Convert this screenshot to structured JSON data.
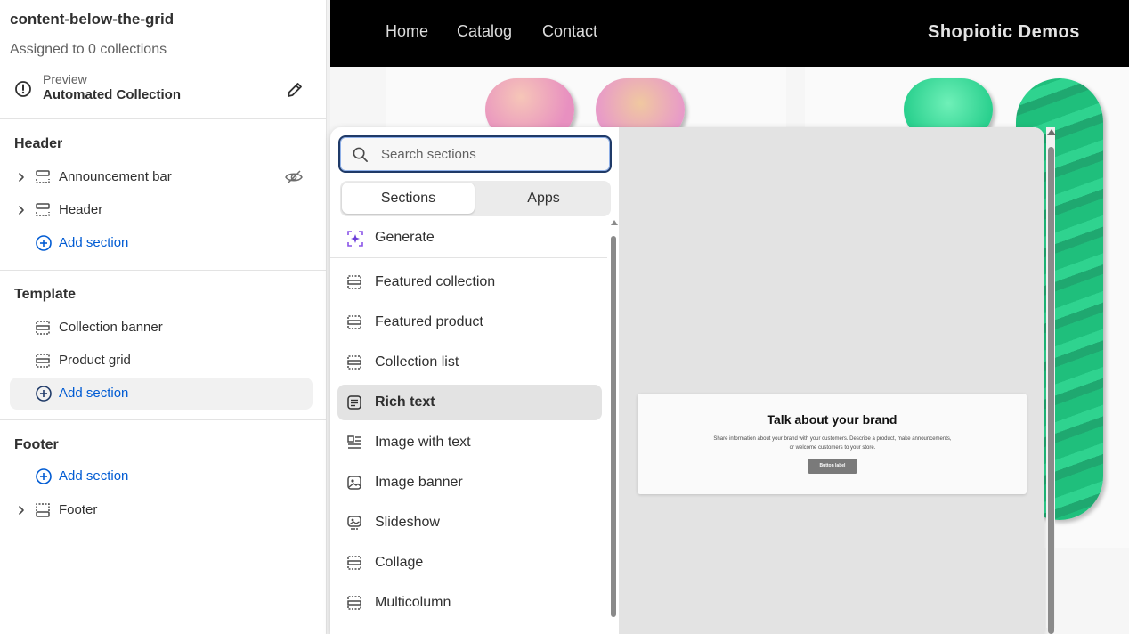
{
  "sidebar": {
    "template_name": "content-below-the-grid",
    "assigned": "Assigned to 0 collections",
    "preview_label": "Preview",
    "preview_value": "Automated Collection",
    "groups": {
      "header": {
        "title": "Header",
        "items": [
          "Announcement bar",
          "Header"
        ],
        "add": "Add section"
      },
      "template": {
        "title": "Template",
        "items": [
          "Collection banner",
          "Product grid"
        ],
        "add": "Add section"
      },
      "footer": {
        "title": "Footer",
        "add": "Add section",
        "items": [
          "Footer"
        ]
      }
    }
  },
  "store": {
    "nav": [
      "Home",
      "Catalog",
      "Contact"
    ],
    "brand": "Shopiotic Demos"
  },
  "popover": {
    "search_placeholder": "Search sections",
    "tabs": [
      "Sections",
      "Apps"
    ],
    "generate": "Generate",
    "sections": [
      "Featured collection",
      "Featured product",
      "Collection list",
      "Rich text",
      "Image with text",
      "Image banner",
      "Slideshow",
      "Collage",
      "Multicolumn"
    ],
    "selected": "Rich text",
    "preview": {
      "title": "Talk about your brand",
      "body_line1": "Share information about your brand with your customers. Describe a product, make announcements,",
      "body_line2": "or welcome customers to your store.",
      "button": "Button label"
    }
  },
  "colors": {
    "accent_blue": "#005bd3",
    "nav_bg": "#000000",
    "selected_bg": "#e3e3e3",
    "generate_purple": "#8a55e8"
  }
}
